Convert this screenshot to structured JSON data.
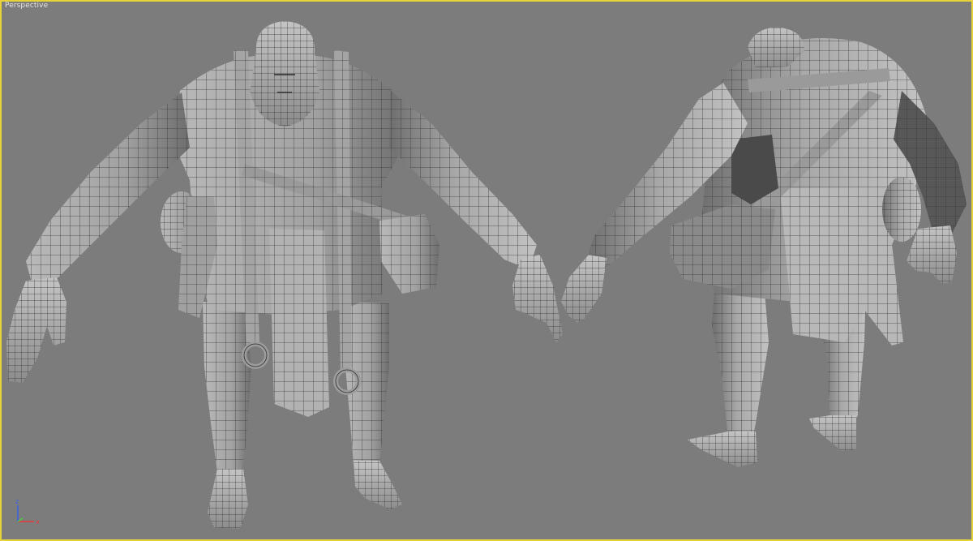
{
  "viewport": {
    "label": "Perspective",
    "border_color": "#e6d23a",
    "background_color": "#7c7c7c"
  },
  "models": [
    {
      "name": "character-front-view",
      "view": "front"
    },
    {
      "name": "character-back-view",
      "view": "back"
    }
  ],
  "axis_gizmo": {
    "z_label": "z",
    "x_label": "x",
    "z_color": "#3a5ee6",
    "x_color": "#e63a3a"
  }
}
